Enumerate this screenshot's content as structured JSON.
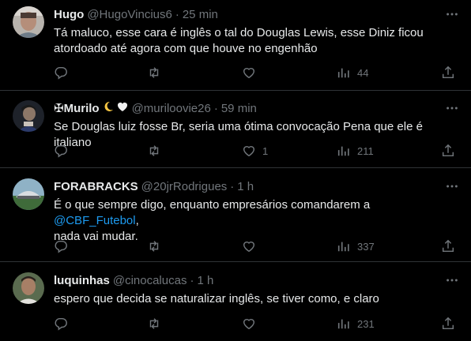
{
  "icons": {
    "reply": "reply-icon",
    "retweet": "retweet-icon",
    "like": "like-icon",
    "views": "views-icon",
    "share": "share-icon",
    "more": "more-icon"
  },
  "colors": {
    "background": "#000000",
    "text": "#e7e9ea",
    "secondary": "#71767b",
    "link": "#1d9bf0",
    "divider": "#2f3336"
  },
  "tweets": [
    {
      "name": "Hugo",
      "handle": "@HugoVincius6",
      "time": "25 min",
      "text": "Tá maluco, esse cara é inglês o tal do Douglas Lewis, esse Diniz ficou atordoado até agora com que houve no engenhão",
      "likes": "",
      "views": "44"
    },
    {
      "name": "✠Murilo",
      "handle": "@muriloovie26",
      "time": "59 min",
      "text": "Se Douglas luiz fosse Br, seria uma ótima convocação Pena que ele é italiano",
      "likes": "1",
      "views": "211"
    },
    {
      "name": "FORABRACKS",
      "handle": "@20jrRodrigues",
      "time": "1 h",
      "text_before": "É o que sempre digo, enquanto empresários comandarem a ",
      "mention": "@CBF_Futebol",
      "text_after": ",",
      "text_line2": "nada vai mudar.",
      "likes": "",
      "views": "337"
    },
    {
      "name": "luquinhas",
      "handle": "@cinocalucas",
      "time": "1 h",
      "text": "espero que decida se naturalizar inglês, se tiver como, e claro",
      "likes": "",
      "views": "231"
    }
  ]
}
